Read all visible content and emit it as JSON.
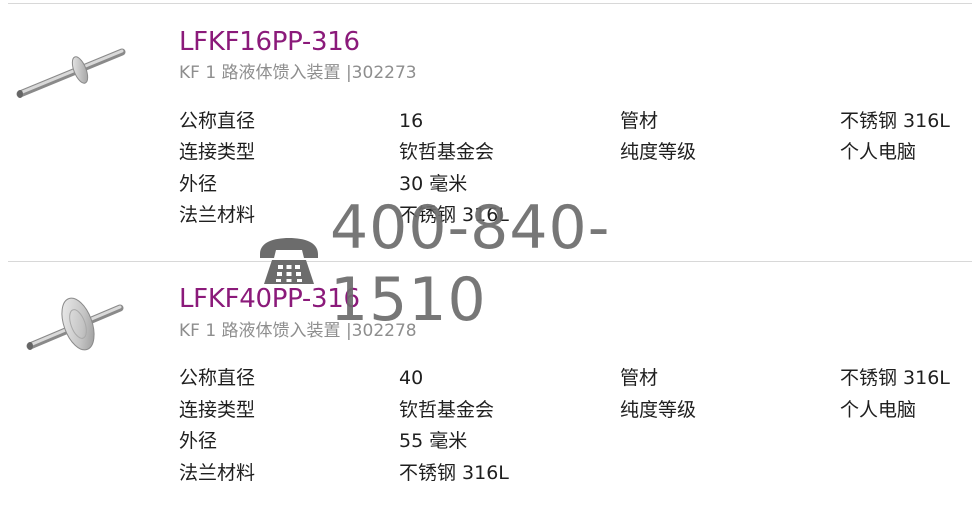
{
  "products": [
    {
      "title": "LFKF16PP-316",
      "subtitle": "KF 1 路液体馈入装置 |302273",
      "specs": [
        {
          "label": "公称直径",
          "value": "16"
        },
        {
          "label": "管材",
          "value": "不锈钢 316L"
        },
        {
          "label": "连接类型",
          "value": "钦哲基金会"
        },
        {
          "label": "纯度等级",
          "value": "个人电脑"
        },
        {
          "label": "外径",
          "value": "30 毫米"
        },
        {
          "label": "法兰材料",
          "value": "不锈钢 316L"
        }
      ]
    },
    {
      "title": "LFKF40PP-316",
      "subtitle": "KF 1 路液体馈入装置 |302278",
      "specs": [
        {
          "label": "公称直径",
          "value": "40"
        },
        {
          "label": "管材",
          "value": "不锈钢 316L"
        },
        {
          "label": "连接类型",
          "value": "钦哲基金会"
        },
        {
          "label": "纯度等级",
          "value": "个人电脑"
        },
        {
          "label": "外径",
          "value": "55 毫米"
        },
        {
          "label": "法兰材料",
          "value": "不锈钢 316L"
        }
      ]
    }
  ],
  "watermark": {
    "icon": "telephone-icon",
    "phone": "400-840-1510"
  },
  "colors": {
    "title": "#8b1a7a",
    "subtitle": "#8e8e8e",
    "text": "#1f1f1f",
    "divider": "#d8d8d8",
    "watermark": "#6c6c6c"
  }
}
